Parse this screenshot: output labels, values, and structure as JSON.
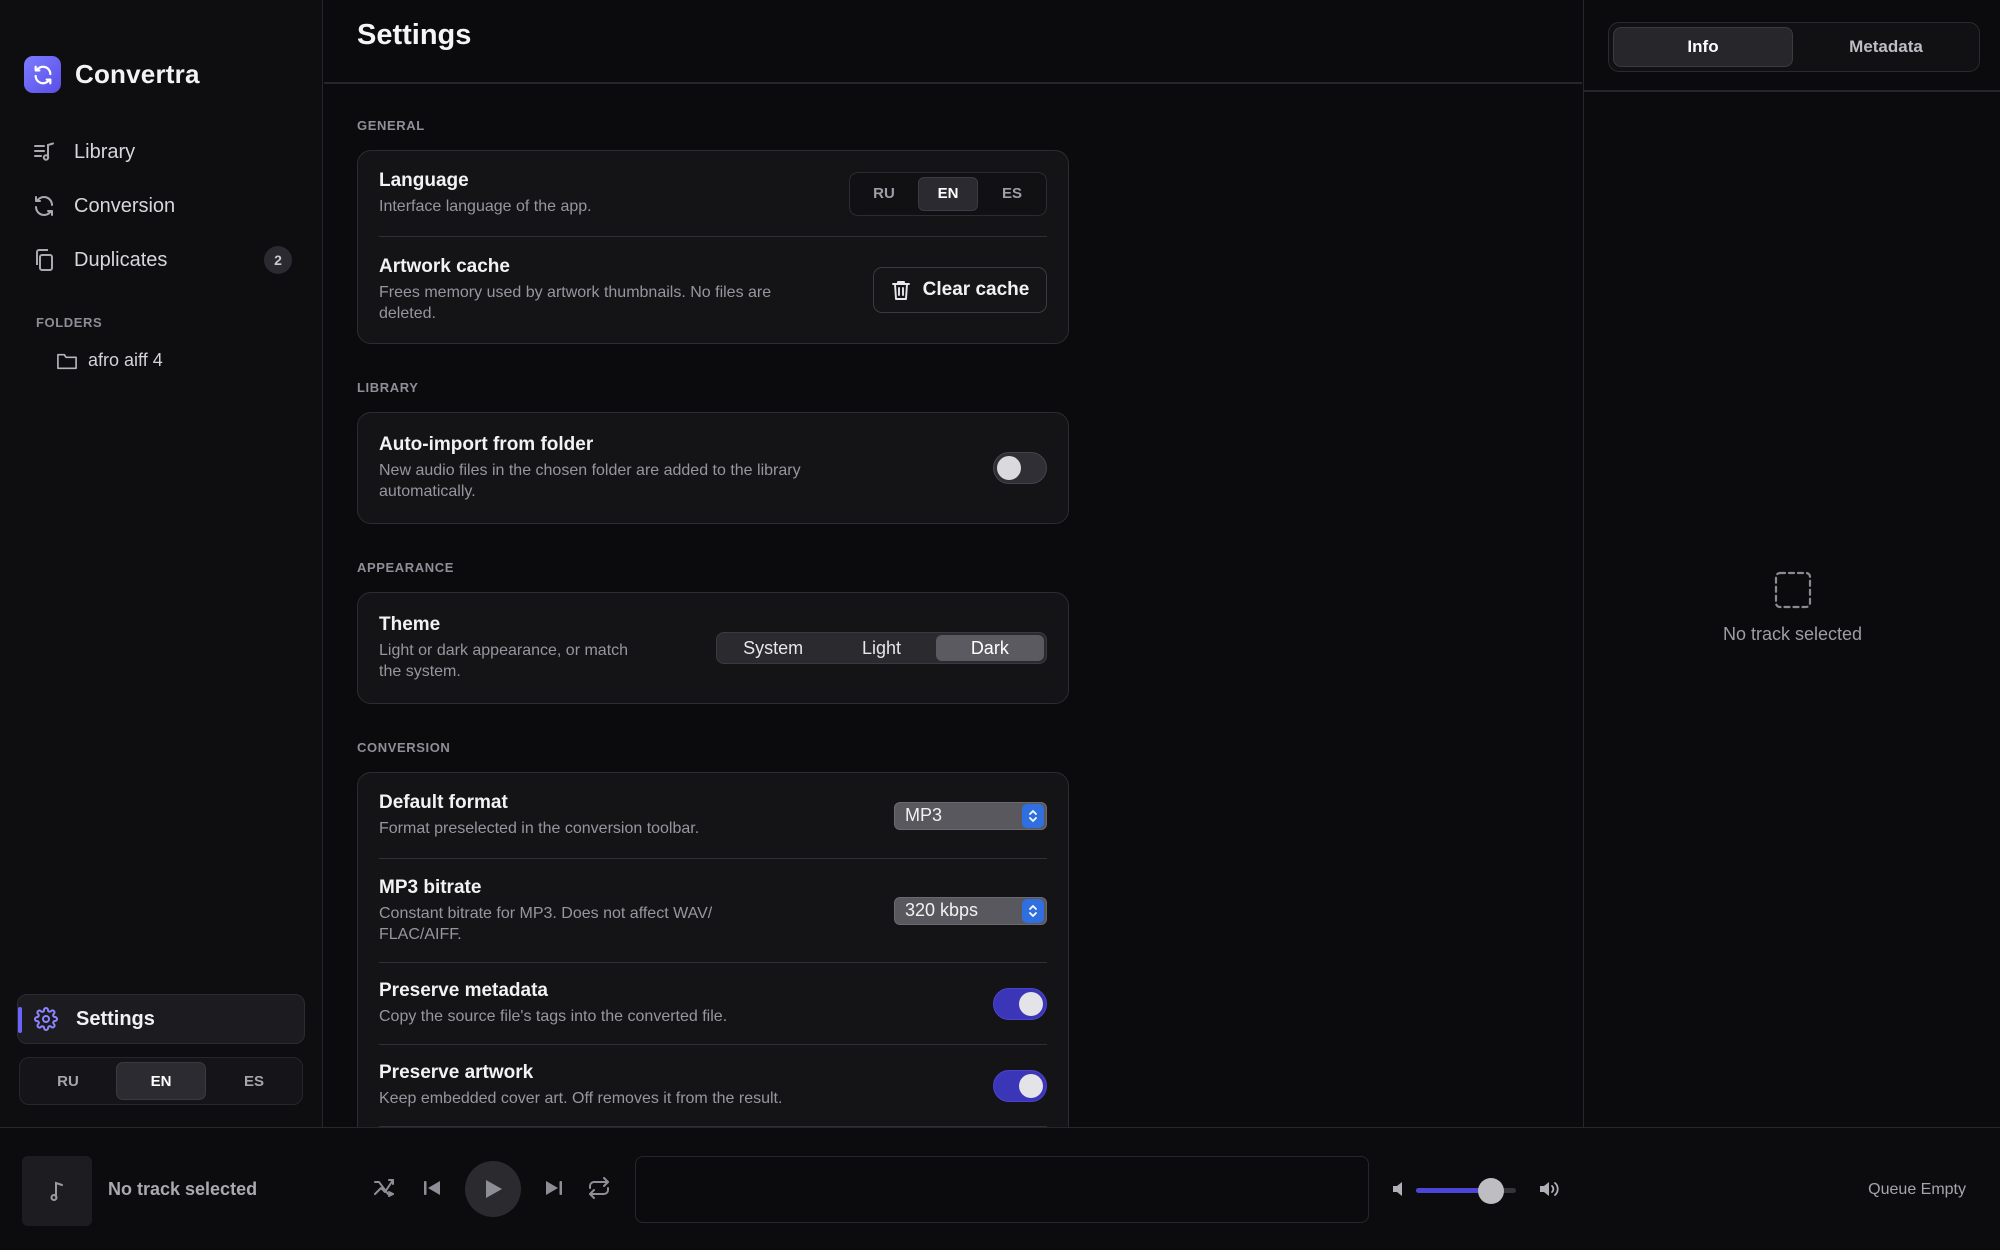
{
  "app": {
    "name": "Convertra",
    "accent": "#6b63ff"
  },
  "sidebar": {
    "nav": [
      {
        "label": "Library",
        "icon": "music-list-icon"
      },
      {
        "label": "Conversion",
        "icon": "refresh-icon"
      },
      {
        "label": "Duplicates",
        "icon": "copy-files-icon",
        "badge": "2"
      }
    ],
    "folders_label": "FOLDERS",
    "folders": [
      {
        "label": "afro aiff 4",
        "icon": "folder-icon"
      }
    ],
    "settings_label": "Settings",
    "languages": [
      "RU",
      "EN",
      "ES"
    ],
    "language_selected": "EN"
  },
  "main": {
    "title": "Settings",
    "sections": {
      "general": {
        "label": "GENERAL",
        "language": {
          "title": "Language",
          "desc": "Interface language of the app.",
          "options": [
            "RU",
            "EN",
            "ES"
          ],
          "selected": "EN"
        },
        "cache": {
          "title": "Artwork cache",
          "desc": "Frees memory used by artwork thumbnails. No files are deleted.",
          "button": "Clear cache"
        }
      },
      "library": {
        "label": "LIBRARY",
        "autoimport": {
          "title": "Auto-import from folder",
          "desc": "New audio files in the chosen folder are added to the library automatically.",
          "enabled": false
        }
      },
      "appearance": {
        "label": "APPEARANCE",
        "theme": {
          "title": "Theme",
          "desc": "Light or dark appearance, or match the system.",
          "options": [
            "System",
            "Light",
            "Dark"
          ],
          "selected": "Dark"
        }
      },
      "conversion": {
        "label": "CONVERSION",
        "format": {
          "title": "Default format",
          "desc": "Format preselected in the conversion toolbar.",
          "value": "MP3"
        },
        "bitrate": {
          "title": "MP3 bitrate",
          "desc": "Constant bitrate for MP3. Does not affect WAV/ FLAC/AIFF.",
          "value": "320 kbps"
        },
        "metadata": {
          "title": "Preserve metadata",
          "desc": "Copy the source file's tags into the converted file.",
          "enabled": true
        },
        "artwork": {
          "title": "Preserve artwork",
          "desc": "Keep embedded cover art. Off removes it from the result.",
          "enabled": true
        }
      }
    }
  },
  "right_panel": {
    "tabs": [
      "Info",
      "Metadata"
    ],
    "active_tab": "Info",
    "empty_text": "No track selected"
  },
  "player": {
    "track": "No track selected",
    "volume": 0.75,
    "queue": "Queue Empty"
  }
}
